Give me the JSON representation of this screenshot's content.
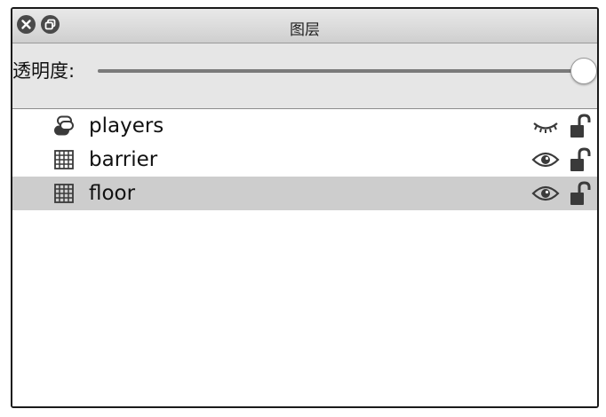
{
  "window": {
    "title": "图层"
  },
  "opacity": {
    "label": "透明度:",
    "value": 1.0
  },
  "layers": [
    {
      "name": "players",
      "type": "object-layer",
      "visible": false,
      "locked": false,
      "selected": false
    },
    {
      "name": "barrier",
      "type": "tile-layer",
      "visible": true,
      "locked": false,
      "selected": false
    },
    {
      "name": "floor",
      "type": "tile-layer",
      "visible": true,
      "locked": false,
      "selected": true
    }
  ],
  "colors": {
    "selection": "#cdcdcd",
    "titlebar": "#d8d8d8",
    "icon": "#3a3a3a"
  }
}
